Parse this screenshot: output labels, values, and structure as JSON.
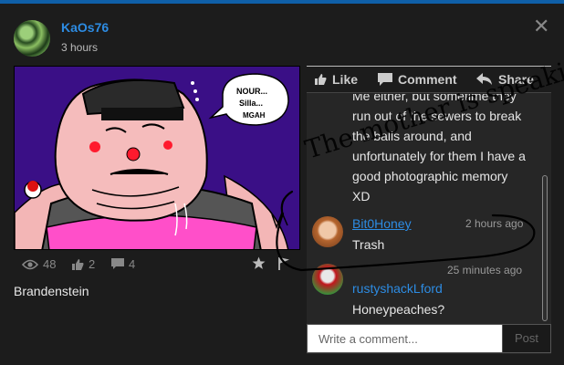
{
  "post": {
    "author": "KaOs76",
    "time_ago": "3 hours",
    "speech_bubble": [
      "NOUR...",
      "Silla...",
      "MGAH"
    ],
    "stats": {
      "views": "48",
      "likes": "2",
      "comments": "4"
    },
    "caption": "Brandenstein"
  },
  "actions": {
    "like": "Like",
    "comment": "Comment",
    "share": "Share"
  },
  "comments": [
    {
      "lines": [
        "Me either, but sometime they",
        "run out of the sewers to break",
        "the balls around, and",
        "unfortunately for them I have a",
        "good photographic memory",
        "XD"
      ]
    },
    {
      "user": "Bit0Honey",
      "time": "2 hours ago",
      "text": "Trash"
    },
    {
      "user": "rustyshackLford",
      "time": "25 minutes ago",
      "text": "Honeypeaches?"
    }
  ],
  "composer": {
    "placeholder": "Write a comment...",
    "post_label": "Post"
  },
  "overlay_handwriting": "The mother is speaking to you!",
  "colors": {
    "accent": "#2d8ce3",
    "topbar": "#0f5fa8",
    "artwork_bg": "#3a0f86",
    "skirt": "#ff4fc9"
  }
}
